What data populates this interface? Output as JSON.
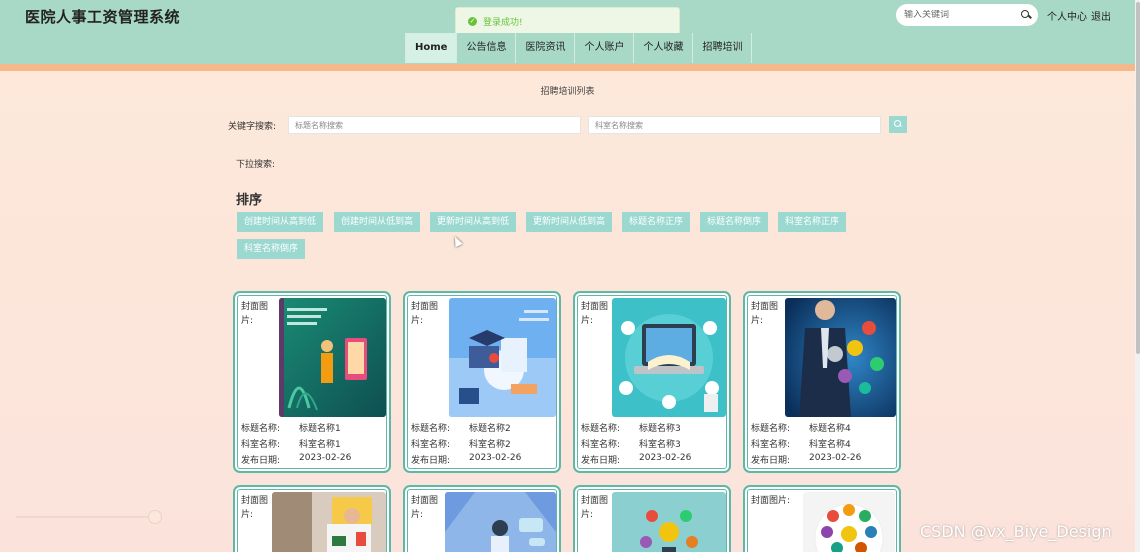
{
  "header": {
    "title": "医院人事工资管理系统",
    "search_placeholder": "输入关键词",
    "user_center": "个人中心",
    "logout": "退出"
  },
  "toast": {
    "message": "登录成功!"
  },
  "nav": {
    "items": [
      {
        "label": "Home"
      },
      {
        "label": "公告信息"
      },
      {
        "label": "医院资讯"
      },
      {
        "label": "个人账户"
      },
      {
        "label": "个人收藏"
      },
      {
        "label": "招聘培训"
      }
    ]
  },
  "page": {
    "heading": "招聘培训列表",
    "keyword_label": "关键字搜索:",
    "title_placeholder": "标题名称搜索",
    "dept_placeholder": "科室名称搜索",
    "dropdown_label": "下拉搜索:",
    "sort_title": "排序"
  },
  "sort_buttons": [
    "创建时间从高到低",
    "创建时间从低到高",
    "更新时间从高到低",
    "更新时间从低到高",
    "标题名称正序",
    "标题名称倒序",
    "科室名称正序",
    "科室名称倒序"
  ],
  "cards": [
    {
      "img_label": "封面图片:",
      "title_label": "标题名称:",
      "title": "标题名称1",
      "dept_label": "科室名称:",
      "dept": "科室名称1",
      "date_label": "发布日期:",
      "date": "2023-02-26",
      "theme": "language"
    },
    {
      "img_label": "封面图片:",
      "title_label": "标题名称:",
      "title": "标题名称2",
      "dept_label": "科室名称:",
      "dept": "科室名称2",
      "date_label": "发布日期:",
      "date": "2023-02-26",
      "theme": "study"
    },
    {
      "img_label": "封面图片:",
      "title_label": "标题名称:",
      "title": "标题名称3",
      "dept_label": "科室名称:",
      "dept": "科室名称3",
      "date_label": "发布日期:",
      "date": "2023-02-26",
      "theme": "online-education"
    },
    {
      "img_label": "封面图片:",
      "title_label": "标题名称:",
      "title": "标题名称4",
      "dept_label": "科室名称:",
      "dept": "科室名称4",
      "date_label": "发布日期:",
      "date": "2023-02-26",
      "theme": "business-icons"
    }
  ],
  "cards_row2": [
    {
      "img_label": "封面图片:"
    },
    {
      "img_label": "封面图片:"
    },
    {
      "img_label": "封面图片:"
    },
    {
      "img_label": "封面图片:"
    }
  ],
  "watermark": "CSDN @vx_Biye_Design",
  "colors": {
    "header_bg": "#a8d8c6",
    "accent_bar": "#f4b88a",
    "button": "#9ad8d0",
    "card_border": "#5fb8a6",
    "page_bg": "#fde9d9"
  }
}
